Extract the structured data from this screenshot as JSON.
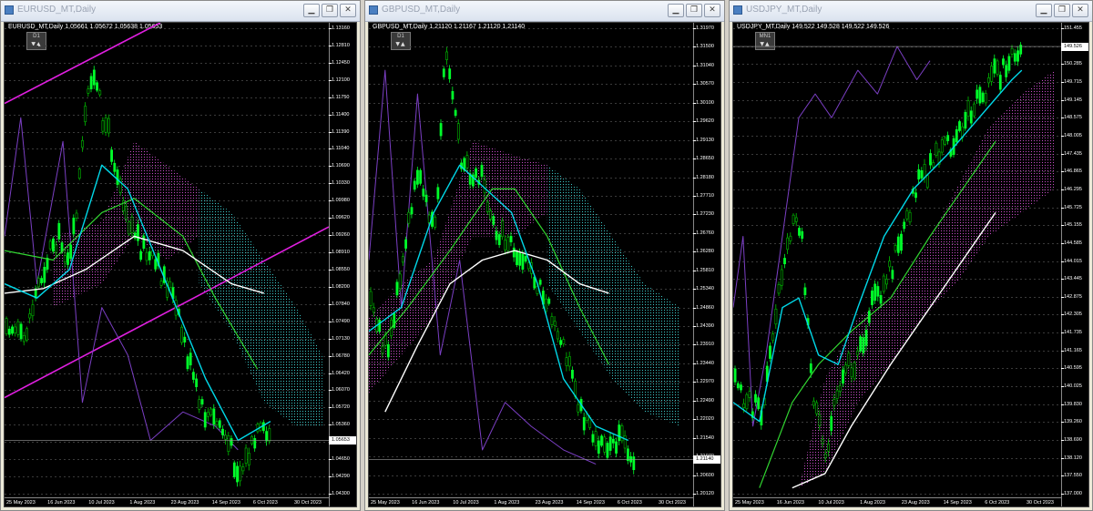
{
  "colors": {
    "bg": "#000000",
    "bull": "#00ff2a",
    "bear": "#00c000",
    "tenkan": "#00d8e8",
    "kijun": "#31d631",
    "ma": "#ffffff",
    "lagging": "#7b3fc4",
    "cloudA": "#d050d0",
    "cloudB": "#3ed0d0",
    "trend": "#e01fe0"
  },
  "windows": [
    {
      "title": "EURUSD_MT,Daily",
      "symbol_info": "EURUSD_MT,Daily  1.05661 1.05672 1.05638 1.05653",
      "tf": "D1",
      "current_price": "1.05653",
      "prices": [
        "1.13160",
        "1.12810",
        "1.12450",
        "1.12100",
        "1.11750",
        "1.11400",
        "1.11390",
        "1.11040",
        "1.10690",
        "1.10330",
        "1.09980",
        "1.09620",
        "1.09260",
        "1.08910",
        "1.08550",
        "1.08200",
        "1.07840",
        "1.07490",
        "1.07130",
        "1.06780",
        "1.06420",
        "1.06070",
        "1.05720",
        "1.05360",
        "1.05000",
        "1.04650",
        "1.04290",
        "1.04300"
      ],
      "dates": [
        "25 May 2023",
        "16 Jun 2023",
        "10 Jul 2023",
        "1 Aug 2023",
        "23 Aug 2023",
        "14 Sep 2023",
        "6 Oct 2023",
        "30 Oct 2023"
      ]
    },
    {
      "title": "GBPUSD_MT,Daily",
      "symbol_info": "GBPUSD_MT,Daily  1.21120 1.21167 1.21120 1.21140",
      "tf": "D1",
      "current_price": "1.21140",
      "prices": [
        "1.31970",
        "1.31500",
        "1.31040",
        "1.30570",
        "1.30100",
        "1.29620",
        "1.29130",
        "1.28650",
        "1.28180",
        "1.27710",
        "1.27230",
        "1.26760",
        "1.26280",
        "1.25810",
        "1.25340",
        "1.24860",
        "1.24390",
        "1.23910",
        "1.23440",
        "1.22970",
        "1.22490",
        "1.22020",
        "1.21540",
        "1.21070",
        "1.20600",
        "1.20120"
      ],
      "dates": [
        "25 May 2023",
        "16 Jun 2023",
        "10 Jul 2023",
        "1 Aug 2023",
        "23 Aug 2023",
        "14 Sep 2023",
        "6 Oct 2023",
        "30 Oct 2023"
      ]
    },
    {
      "title": "USDJPY_MT,Daily",
      "symbol_info": "USDJPY_MT,Daily  149.522 149.528 149.522 149.526",
      "tf": "MN1",
      "current_price": "149.526",
      "prices": [
        "151.455",
        "150.855",
        "150.285",
        "149.715",
        "149.145",
        "148.575",
        "148.005",
        "147.435",
        "146.865",
        "146.295",
        "145.725",
        "145.155",
        "144.585",
        "144.015",
        "143.445",
        "142.875",
        "142.305",
        "141.735",
        "141.165",
        "140.595",
        "140.025",
        "139.830",
        "139.260",
        "138.690",
        "138.120",
        "137.550",
        "137.000"
      ],
      "dates": [
        "25 May 2023",
        "16 Jun 2023",
        "10 Jul 2023",
        "1 Aug 2023",
        "23 Aug 2023",
        "14 Sep 2023",
        "6 Oct 2023",
        "30 Oct 2023"
      ]
    }
  ]
}
